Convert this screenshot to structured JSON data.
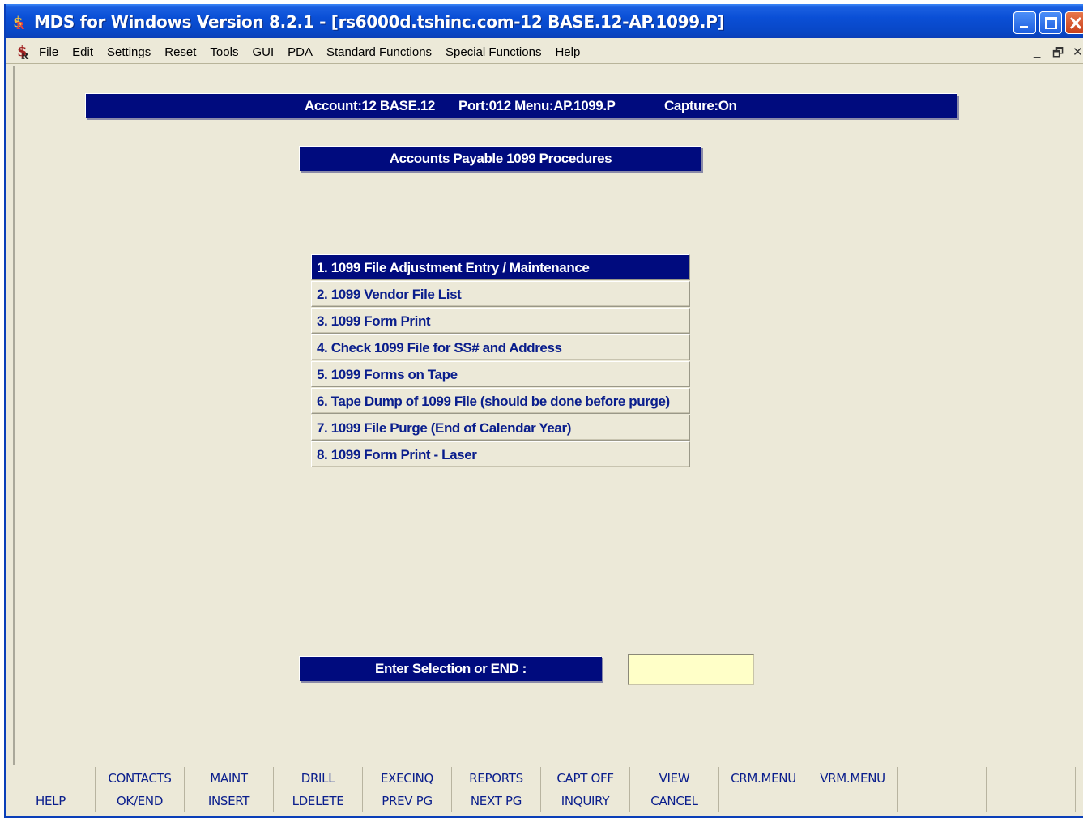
{
  "window": {
    "title": "MDS for Windows Version 8.2.1 - [rs6000d.tshinc.com-12 BASE.12-AP.1099.P]"
  },
  "menubar": {
    "items": [
      "File",
      "Edit",
      "Settings",
      "Reset",
      "Tools",
      "GUI",
      "PDA",
      "Standard Functions",
      "Special Functions",
      "Help"
    ],
    "mdi_minimize": "_",
    "mdi_restore": "🗗",
    "mdi_close": "✕"
  },
  "status_bar": {
    "account": "Account:12 BASE.12",
    "port_menu": "Port:012 Menu:AP.1099.P",
    "capture": "Capture:On"
  },
  "menu": {
    "title": "Accounts Payable 1099 Procedures",
    "items": [
      "1. 1099 File Adjustment Entry / Maintenance",
      "2. 1099 Vendor File List",
      "3. 1099 Form Print",
      "4. Check 1099 File for SS# and Address",
      "5. 1099 Forms on Tape",
      "6. Tape Dump of 1099 File (should be done before purge)",
      "7. 1099 File Purge (End of Calendar Year)",
      "8. 1099 Form Print - Laser"
    ],
    "selected_index": 0
  },
  "selection": {
    "label": "Enter Selection or END :",
    "value": ""
  },
  "function_keys": {
    "top": [
      "",
      "CONTACTS",
      "MAINT",
      "DRILL",
      "EXECINQ",
      "REPORTS",
      "CAPT OFF",
      "VIEW",
      "CRM.MENU",
      "VRM.MENU",
      "",
      ""
    ],
    "bottom": [
      "HELP",
      "OK/END",
      "INSERT",
      "LDELETE",
      "PREV PG",
      "NEXT PG",
      "INQUIRY",
      "CANCEL",
      "",
      "",
      "",
      ""
    ]
  },
  "colors": {
    "nav_bar": "#000b7e",
    "background": "#ece9d8",
    "menu_text": "#0a1e8c",
    "input_bg": "#ffffc8"
  }
}
